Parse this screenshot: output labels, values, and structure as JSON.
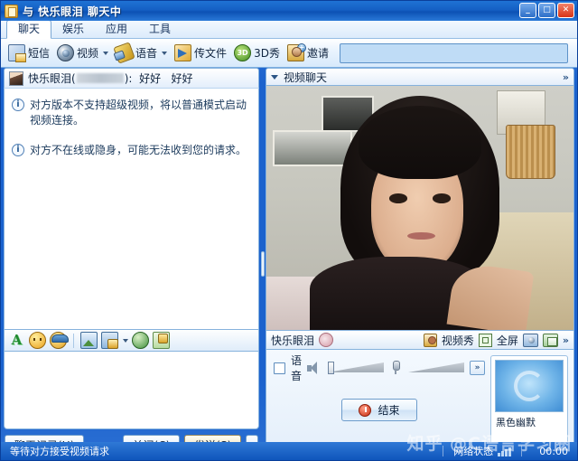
{
  "window": {
    "title": "与 快乐眼泪 聊天中",
    "icon": "qq-chat-icon",
    "minimize": "_",
    "maximize": "□",
    "close": "✕"
  },
  "menu": {
    "items": [
      {
        "label": "聊天",
        "active": true
      },
      {
        "label": "娱乐",
        "active": false
      },
      {
        "label": "应用",
        "active": false
      },
      {
        "label": "工具",
        "active": false
      }
    ]
  },
  "toolbar": {
    "items": [
      {
        "label": "短信",
        "icon": "sms-icon",
        "dropdown": false
      },
      {
        "label": "视频",
        "icon": "webcam-icon",
        "dropdown": true
      },
      {
        "label": "语音",
        "icon": "microphone-icon",
        "dropdown": true
      },
      {
        "label": "传文件",
        "icon": "file-transfer-icon",
        "dropdown": false
      },
      {
        "label": "3D秀",
        "icon": "three-d-show-icon",
        "dropdown": false
      },
      {
        "label": "邀请",
        "icon": "invite-user-icon",
        "dropdown": false
      }
    ],
    "input_value": "",
    "input_placeholder": ""
  },
  "chat": {
    "header": {
      "name": "快乐眼泪",
      "paren_open": "(",
      "paren_close": ")",
      "separator": ":",
      "status_text_1": "好好",
      "status_text_2": "好好",
      "uin_masked": ""
    },
    "messages": [
      {
        "icon": "info-icon",
        "text": "对方版本不支持超级视频，将以普通模式启动视频连接。"
      },
      {
        "icon": "info-icon",
        "text": "对方不在线或隐身，可能无法收到您的请求。"
      }
    ],
    "input_toolbar": [
      {
        "icon": "font-format-icon",
        "glyph": "A",
        "dropdown": false
      },
      {
        "icon": "emoticon-icon",
        "dropdown": false
      },
      {
        "icon": "magic-expression-icon",
        "dropdown": false
      },
      {
        "icon": "send-image-icon",
        "dropdown": false
      },
      {
        "icon": "screen-capture-icon",
        "dropdown": true
      },
      {
        "icon": "shake-window-icon",
        "dropdown": false
      },
      {
        "icon": "send-gift-icon",
        "dropdown": false
      }
    ],
    "input_value": "",
    "buttons": {
      "history": "聊天记录(H)",
      "close": "关闭(C)",
      "send": "发送(S)",
      "send_dropdown": "▾"
    }
  },
  "video": {
    "header": {
      "title": "视频聊天",
      "collapse_icon": "triangle-down-icon",
      "expand_icon": "chevron-double-right-icon"
    },
    "toolbar": {
      "peer_name": "快乐眼泪",
      "mute_icon": "mute-peer-icon",
      "show_label": "视频秀",
      "show_icon": "video-show-icon",
      "fullscreen_label": "全屏",
      "fullscreen_icon": "fullscreen-icon",
      "snapshot_icon": "snapshot-camera-icon",
      "save_icon": "save-video-icon",
      "more_icon": "chevron-double-right-icon"
    },
    "audio": {
      "voice_checkbox_label": "语音",
      "voice_checked": false,
      "speaker_icon": "speaker-muted-icon",
      "speaker_level": 0,
      "microphone_icon": "microphone-icon",
      "microphone_level": 0,
      "more_icon": "chevron-double-right-icon"
    },
    "end_button": {
      "label": "结束",
      "icon": "power-off-icon"
    },
    "thumbnail": {
      "label": "黑色幽默",
      "badge_icon": "avatar-badge-icon"
    }
  },
  "statusbar": {
    "message": "等待对方接受视频请求",
    "network_label": "网络状态",
    "network_icon": "signal-bars-icon",
    "duration": "00:00"
  },
  "watermark": {
    "text": "知乎 @C语言学习圈"
  }
}
